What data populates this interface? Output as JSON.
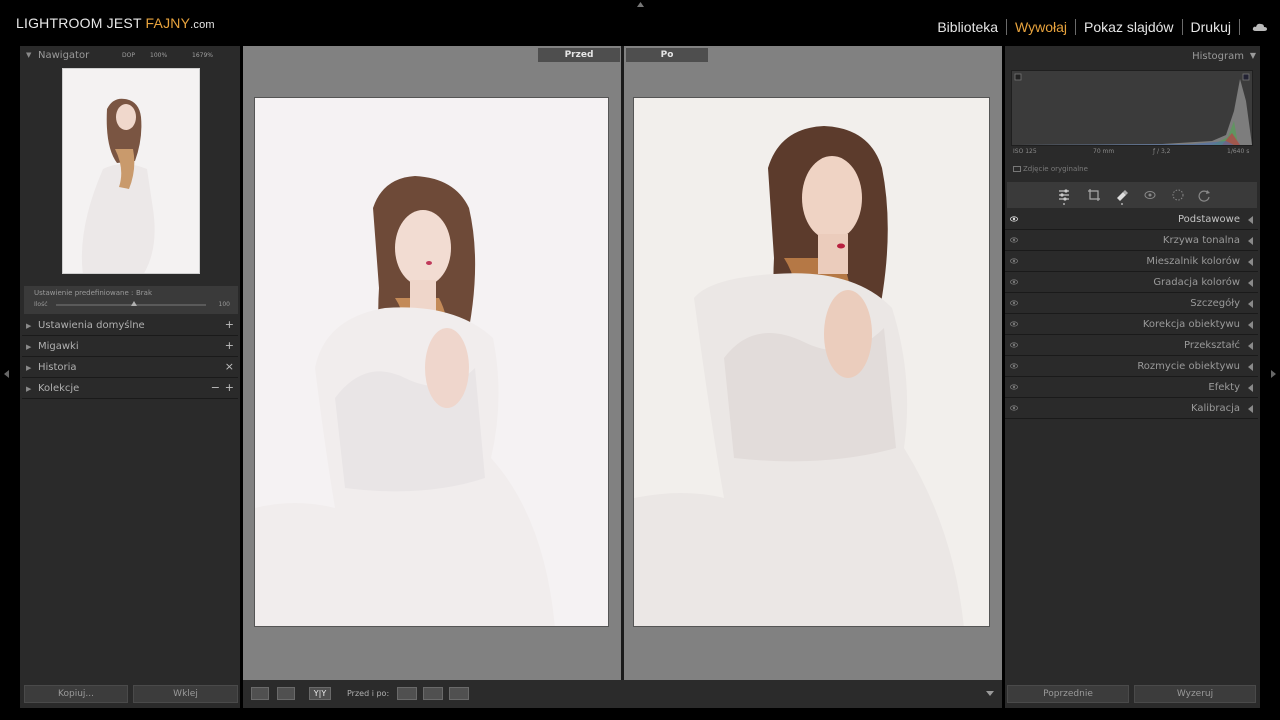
{
  "brand": {
    "prefix": "LIGHTROOM JEST ",
    "accent": "FAJNY",
    "suffix": ".com",
    "accent_color": "#e8a33d"
  },
  "modules": [
    {
      "label": "Biblioteka",
      "active": false
    },
    {
      "label": "Wywołaj",
      "active": true
    },
    {
      "label": "Pokaz slajdów",
      "active": false
    },
    {
      "label": "Drukuj",
      "active": false
    }
  ],
  "navigator": {
    "title": "Nawigator",
    "zoom_fit": "DOP",
    "zoom_100": "100%",
    "zoom_custom": "1679%"
  },
  "preset": {
    "name": "Ustawienie predefiniowane :",
    "value": "Brak",
    "amount_label": "Ilość",
    "amount_value": "100",
    "amount_level": 0.5
  },
  "left_sections": [
    {
      "label": "Ustawienia domyślne",
      "actions": [
        "+"
      ]
    },
    {
      "label": "Migawki",
      "actions": [
        "+"
      ]
    },
    {
      "label": "Historia",
      "actions": [
        "×"
      ]
    },
    {
      "label": "Kolekcje",
      "actions": [
        "−",
        "+"
      ]
    }
  ],
  "left_buttons": {
    "copy": "Kopiuj...",
    "paste": "Wklej"
  },
  "compare": {
    "before": "Przed",
    "after": "Po"
  },
  "toolbar": {
    "before_after_label": "Przed i po:",
    "view_mode": "Y|Y"
  },
  "histogram": {
    "title": "Histogram",
    "iso": "ISO 125",
    "focal": "70 mm",
    "aperture": "ƒ / 3,2",
    "shutter": "1/640 s",
    "original_label": "Zdjęcie oryginalne"
  },
  "right_sections": [
    "Podstawowe",
    "Krzywa tonalna",
    "Mieszalnik kolorów",
    "Gradacja kolorów",
    "Szczegóły",
    "Korekcja obiektywu",
    "Przekształć",
    "Rozmycie obiektywu",
    "Efekty",
    "Kalibracja"
  ],
  "right_buttons": {
    "previous": "Poprzednie",
    "reset": "Wyzeruj"
  }
}
